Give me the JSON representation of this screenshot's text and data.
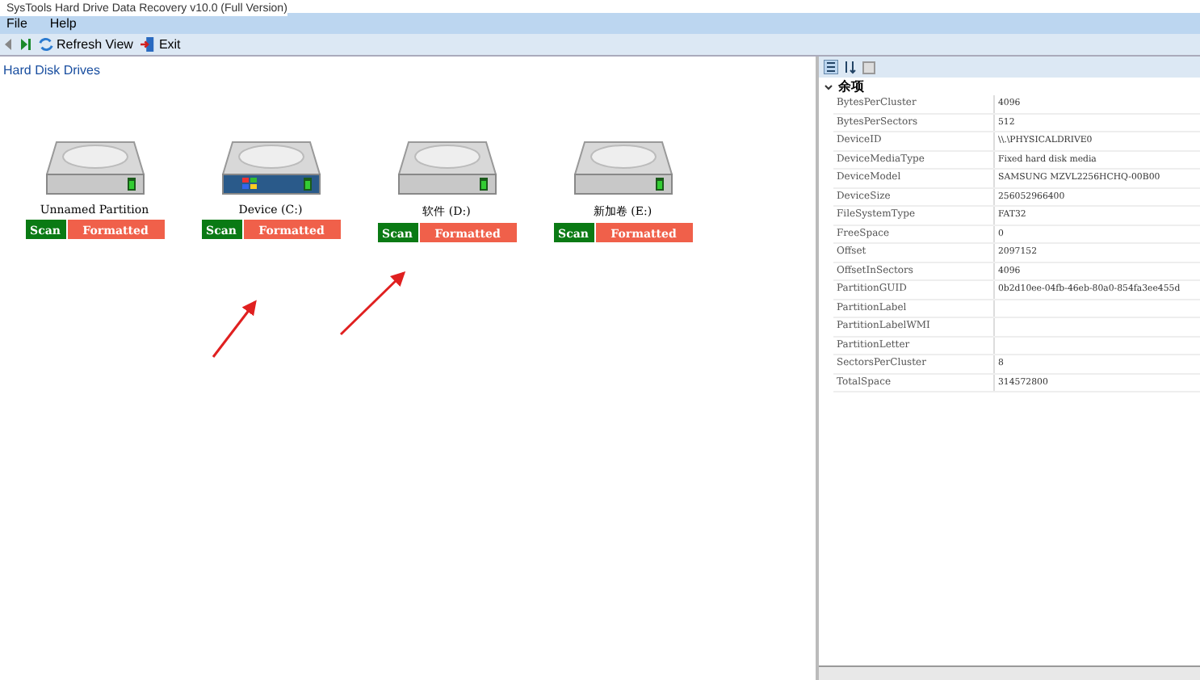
{
  "window": {
    "title": "SysTools Hard Drive Data Recovery v10.0 (Full Version)"
  },
  "menu": [
    "File",
    "Help"
  ],
  "toolbar": [
    {
      "kind": "back"
    },
    {
      "kind": "forward"
    },
    {
      "kind": "refresh",
      "label": "Refresh View"
    },
    {
      "kind": "exit",
      "label": "Exit"
    }
  ],
  "drives_panel": {
    "title": "Hard Disk Drives",
    "drives": [
      {
        "name": "Unnamed Partition",
        "kind": "plain",
        "scan": "Scan",
        "status": "Formatted"
      },
      {
        "name": "Device (C:)",
        "kind": "system",
        "scan": "Scan",
        "status": "Formatted"
      },
      {
        "name": "软件 (D:)",
        "kind": "plain",
        "scan": "Scan",
        "status": "Formatted"
      },
      {
        "name": "新加卷 (E:)",
        "kind": "plain",
        "scan": "Scan",
        "status": "Formatted"
      }
    ]
  },
  "properties": {
    "category": "余项",
    "expanded": true,
    "rows": [
      {
        "name": "BytesPerCluster",
        "value": "4096"
      },
      {
        "name": "BytesPerSectors",
        "value": "512"
      },
      {
        "name": "DeviceID",
        "value": "\\\\.\\PHYSICALDRIVE0"
      },
      {
        "name": "DeviceMediaType",
        "value": "Fixed hard disk media"
      },
      {
        "name": "DeviceModel",
        "value": "SAMSUNG MZVL2256HCHQ-00B00"
      },
      {
        "name": "DeviceSize",
        "value": "256052966400"
      },
      {
        "name": "FileSystemType",
        "value": "FAT32"
      },
      {
        "name": "FreeSpace",
        "value": "0"
      },
      {
        "name": "Offset",
        "value": "2097152"
      },
      {
        "name": "OffsetInSectors",
        "value": "4096"
      },
      {
        "name": "PartitionGUID",
        "value": "0b2d10ee-04fb-46eb-80a0-854fa3ee455d"
      },
      {
        "name": "PartitionLabel"
      },
      {
        "name": "PartitionLabelWMI"
      },
      {
        "name": "PartitionLetter"
      },
      {
        "name": "SectorsPerCluster",
        "value": "8"
      },
      {
        "name": "TotalSpace",
        "value": "314572800"
      }
    ]
  }
}
